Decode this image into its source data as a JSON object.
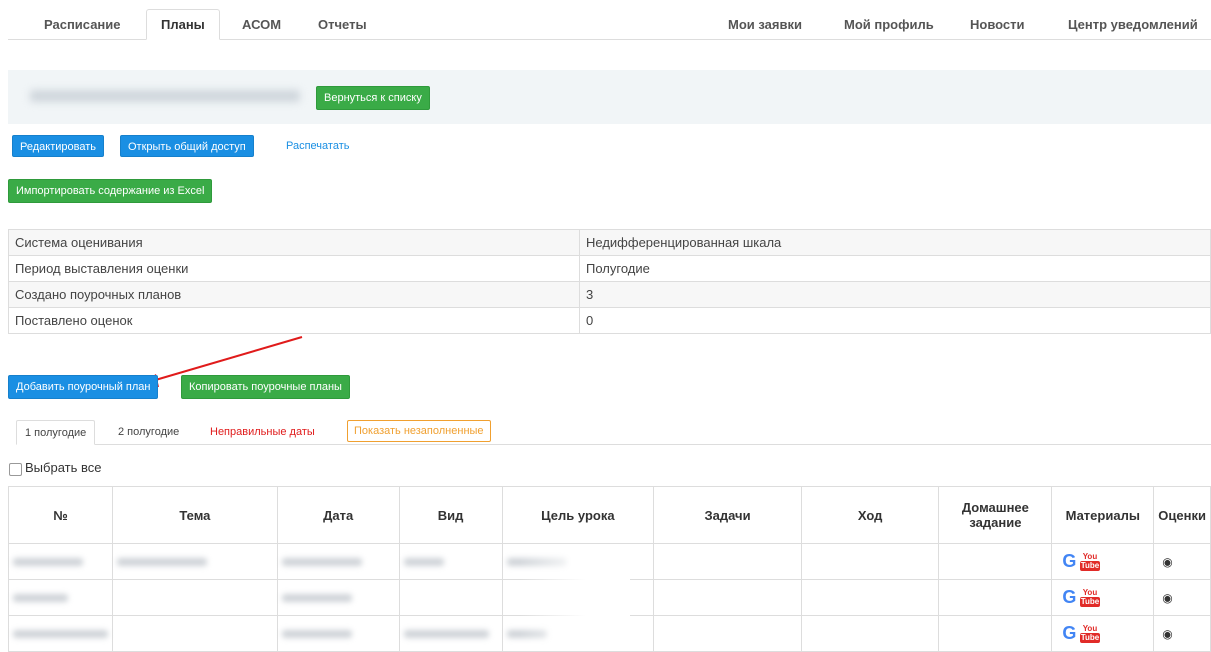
{
  "nav": {
    "left_tabs": [
      "Расписание",
      "Планы",
      "АСОМ",
      "Отчеты"
    ],
    "active_tab": "Планы",
    "right_tabs": [
      "Мои заявки",
      "Мой профиль",
      "Новости",
      "Центр уведомлений"
    ]
  },
  "header": {
    "back_button": "Вернуться к списку"
  },
  "actions": {
    "edit": "Редактировать",
    "share": "Открыть общий доступ",
    "print": "Распечатать",
    "import_excel": "Импортировать содержание из Excel"
  },
  "info": [
    {
      "label": "Система оценивания",
      "value": "Недифференцированная шкала"
    },
    {
      "label": "Период выставления оценки",
      "value": "Полугодие"
    },
    {
      "label": "Создано поурочных планов",
      "value": "3"
    },
    {
      "label": "Поставлено оценок",
      "value": "0"
    }
  ],
  "plan_actions": {
    "add_plan": "Добавить поурочный план",
    "copy_plans": "Копировать поурочные планы"
  },
  "subtabs": {
    "first": "1 полугодие",
    "second": "2 полугодие",
    "wrong_dates": "Неправильные даты",
    "show_unfilled": "Показать незаполненные"
  },
  "select_all": "Выбрать все",
  "lessons_table": {
    "columns": [
      "№",
      "Тема",
      "Дата",
      "Вид",
      "Цель урока",
      "Задачи",
      "Ход",
      "Домашнее задание",
      "Материалы",
      "Оценки"
    ]
  },
  "icons": {
    "google": "G",
    "youtube_top": "You",
    "youtube_bottom": "Tube"
  },
  "colors": {
    "primary": "#1a8fe3",
    "success": "#3aab47",
    "danger": "#e01b1b",
    "warning": "#f0a030"
  }
}
